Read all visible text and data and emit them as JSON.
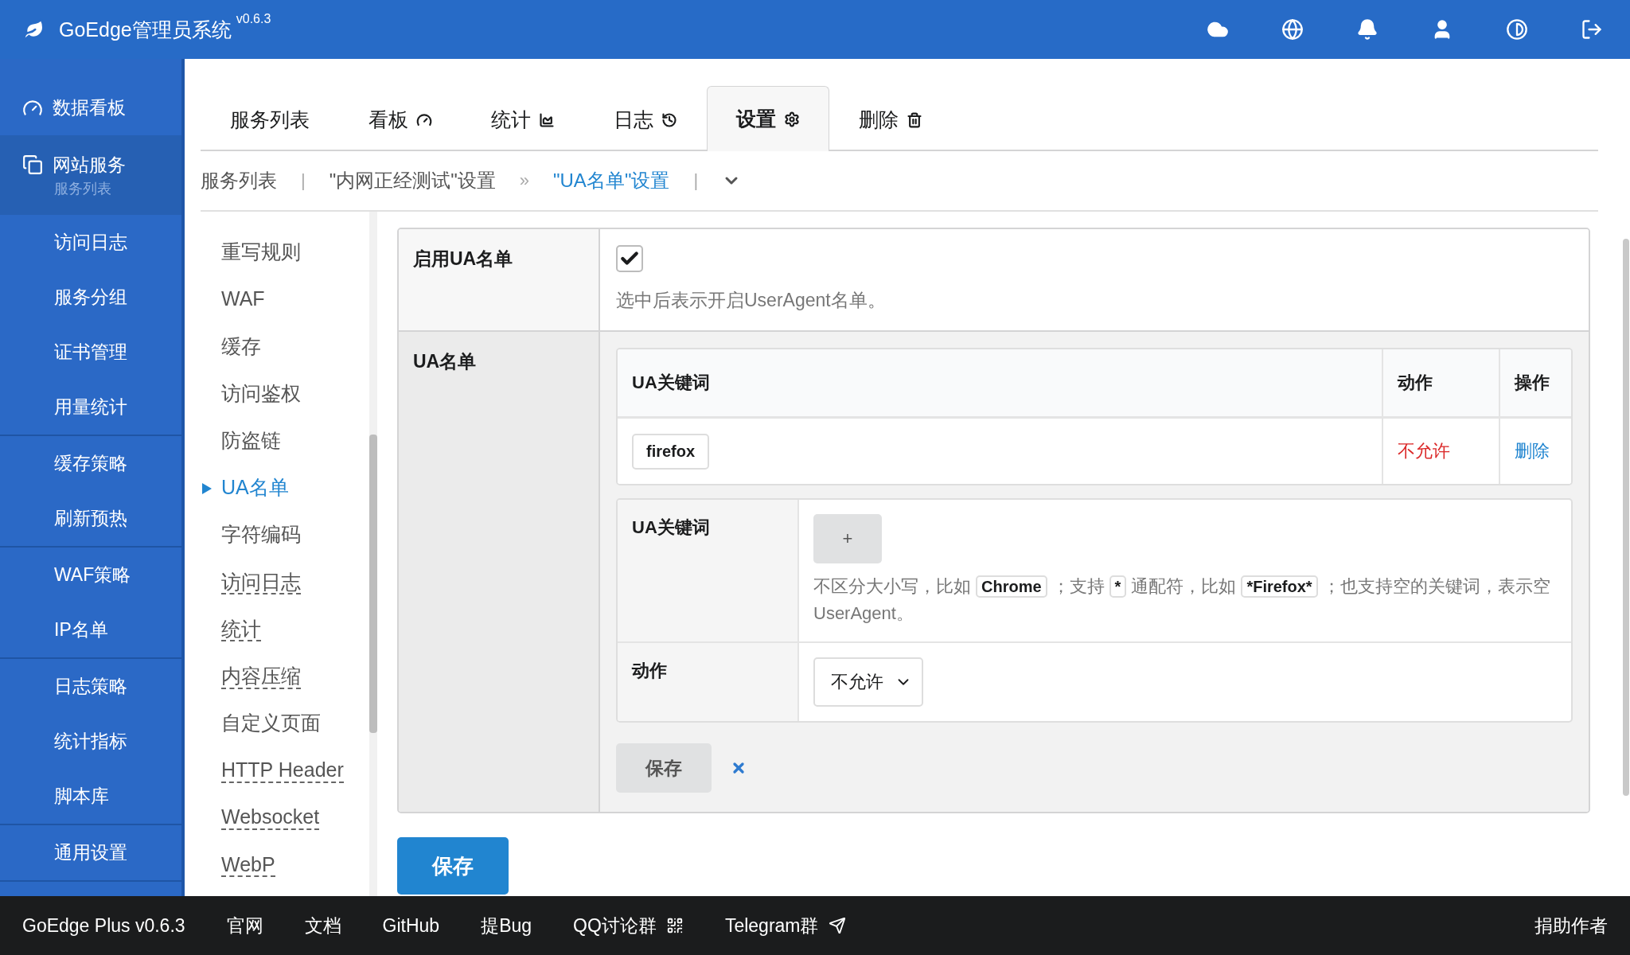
{
  "header": {
    "title": "GoEdge管理员系统",
    "version": "v0.6.3"
  },
  "sidebar": {
    "groups": [
      [
        {
          "label": "数据看板",
          "selected": false
        },
        {
          "label": "网站服务",
          "sublabel": "服务列表",
          "selected": true
        },
        {
          "label": "访问日志",
          "selected": false
        },
        {
          "label": "服务分组",
          "selected": false
        },
        {
          "label": "证书管理",
          "selected": false
        },
        {
          "label": "用量统计",
          "selected": false
        }
      ],
      [
        {
          "label": "缓存策略",
          "selected": false
        },
        {
          "label": "刷新预热",
          "selected": false
        }
      ],
      [
        {
          "label": "WAF策略",
          "selected": false
        },
        {
          "label": "IP名单",
          "selected": false
        }
      ],
      [
        {
          "label": "日志策略",
          "selected": false
        },
        {
          "label": "统计指标",
          "selected": false
        },
        {
          "label": "脚本库",
          "selected": false
        }
      ],
      [
        {
          "label": "通用设置",
          "selected": false
        }
      ]
    ]
  },
  "tabs": [
    {
      "label": "服务列表",
      "selected": false
    },
    {
      "label": "看板",
      "selected": false
    },
    {
      "label": "统计",
      "selected": false
    },
    {
      "label": "日志",
      "selected": false
    },
    {
      "label": "设置",
      "selected": true
    },
    {
      "label": "删除",
      "selected": false
    }
  ],
  "breadcrumb": [
    {
      "text": "服务列表",
      "kind": "link"
    },
    {
      "text": "|",
      "kind": "separator"
    },
    {
      "text": "\"内网正经测试\"设置",
      "kind": "link"
    },
    {
      "text": "»",
      "kind": "separator"
    },
    {
      "text": "\"UA名单\"设置",
      "kind": "current"
    },
    {
      "text": "|",
      "kind": "separator"
    },
    {
      "kind": "dropdown"
    }
  ],
  "submenu": [
    {
      "label": "重写规则",
      "selected": false,
      "underlined": false
    },
    {
      "label": "WAF",
      "selected": false,
      "underlined": false
    },
    {
      "label": "缓存",
      "selected": false,
      "underlined": false
    },
    {
      "label": "访问鉴权",
      "selected": false,
      "underlined": false
    },
    {
      "label": "防盗链",
      "selected": false,
      "underlined": false
    },
    {
      "label": "UA名单",
      "selected": true,
      "underlined": false
    },
    {
      "label": "字符编码",
      "selected": false,
      "underlined": false
    },
    {
      "label": "访问日志",
      "selected": false,
      "underlined": true
    },
    {
      "label": "统计",
      "selected": false,
      "underlined": true
    },
    {
      "label": "内容压缩",
      "selected": false,
      "underlined": true
    },
    {
      "label": "自定义页面",
      "selected": false,
      "underlined": false
    },
    {
      "label": "HTTP Header",
      "selected": false,
      "underlined": true
    },
    {
      "label": "Websocket",
      "selected": false,
      "underlined": true
    },
    {
      "label": "WebP",
      "selected": false,
      "underlined": true
    }
  ],
  "form": {
    "enable": {
      "label": "启用UA名单",
      "checked": true,
      "hint": "选中后表示开启UserAgent名单。"
    },
    "list": {
      "label": "UA名单",
      "columns": [
        "UA关键词",
        "动作",
        "操作"
      ],
      "rows": [
        {
          "keyword": "firefox",
          "action": "不允许",
          "operation": "删除"
        }
      ],
      "add_form": {
        "keyword_label": "UA关键词",
        "add_button": "+",
        "help": [
          {
            "text": "不区分大小写，比如",
            "kind": "text"
          },
          {
            "text": "Chrome",
            "kind": "code"
          },
          {
            "text": "；支持",
            "kind": "text"
          },
          {
            "text": "*",
            "kind": "code"
          },
          {
            "text": "通配符，比如",
            "kind": "text"
          },
          {
            "text": "*Firefox*",
            "kind": "code"
          },
          {
            "text": "；也支持空的关键词，表示空UserAgent。",
            "kind": "text"
          }
        ],
        "action_label": "动作",
        "action_value": "不允许",
        "save": "保存"
      }
    },
    "submit": "保存"
  },
  "footer": {
    "links": [
      "GoEdge Plus v0.6.3",
      "官网",
      "文档",
      "GitHub",
      "提Bug",
      "QQ讨论群",
      "Telegram群"
    ],
    "right": "捐助作者"
  }
}
